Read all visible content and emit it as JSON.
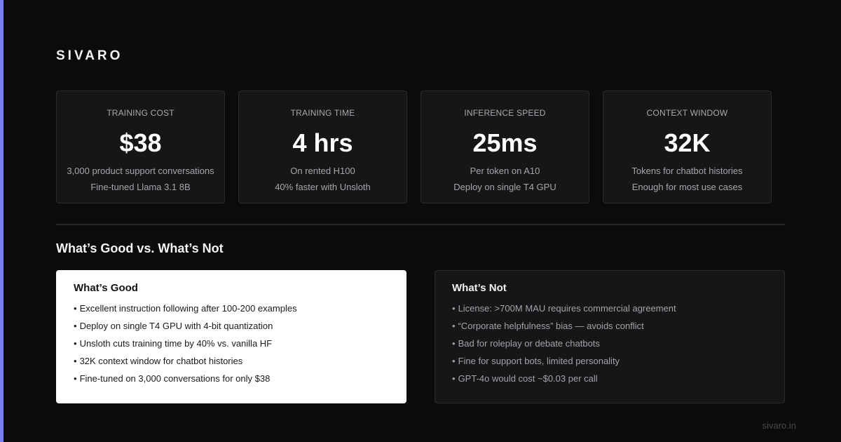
{
  "brand": "SIVARO",
  "stats": [
    {
      "label": "TRAINING COST",
      "value": "$38",
      "line1": "3,000 product support conversations",
      "line2": "Fine-tuned Llama 3.1 8B"
    },
    {
      "label": "TRAINING TIME",
      "value": "4 hrs",
      "line1": "On rented H100",
      "line2": "40% faster with Unsloth"
    },
    {
      "label": "INFERENCE SPEED",
      "value": "25ms",
      "line1": "Per token on A10",
      "line2": "Deploy on single T4 GPU"
    },
    {
      "label": "CONTEXT WINDOW",
      "value": "32K",
      "line1": "Tokens for chatbot histories",
      "line2": "Enough for most use cases"
    }
  ],
  "section_title": "What’s Good vs. What’s Not",
  "good": {
    "title": "What’s Good",
    "items": [
      "Excellent instruction following after 100-200 examples",
      "Deploy on single T4 GPU with 4-bit quantization",
      "Unsloth cuts training time by 40% vs. vanilla HF",
      "32K context window for chatbot histories",
      "Fine-tuned on 3,000 conversations for only $38"
    ]
  },
  "not": {
    "title": "What’s Not",
    "items": [
      "License: >700M MAU requires commercial agreement",
      "“Corporate helpfulness” bias — avoids conflict",
      "Bad for roleplay or debate chatbots",
      "Fine for support bots, limited personality",
      "GPT-4o would cost ~$0.03 per call"
    ]
  },
  "bullet": "•",
  "footer": "sivaro.in",
  "colors": {
    "accent": "#7b80f0",
    "background": "#0b0b0b",
    "card": "#161618"
  }
}
